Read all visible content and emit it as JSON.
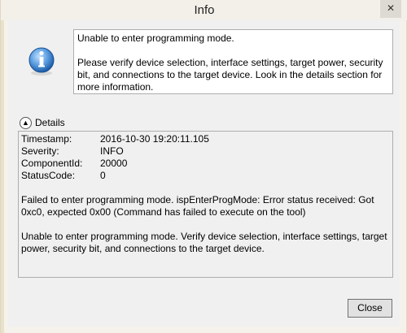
{
  "window": {
    "title": "Info",
    "close_glyph": "✕"
  },
  "message": {
    "icon": "info-icon",
    "line1": "Unable to enter programming mode.",
    "line2": "Please verify device selection, interface settings, target power, security bit, and connections to the target device. Look in the details section for more information."
  },
  "details": {
    "toggle_glyph": "▲",
    "label": "Details",
    "fields": [
      {
        "key": "Timestamp:",
        "value": "2016-10-30 19:20:11.105"
      },
      {
        "key": "Severity:",
        "value": "INFO"
      },
      {
        "key": "ComponentId:",
        "value": "20000"
      },
      {
        "key": "StatusCode:",
        "value": "0"
      }
    ],
    "paragraph1": "Failed to enter programming mode. ispEnterProgMode: Error status received: Got 0xc0, expected 0x00 (Command has failed to execute on the tool)",
    "paragraph2": "Unable to enter programming mode. Verify device selection, interface settings, target power, security bit, and connections to the target device."
  },
  "buttons": {
    "close_label": "Close"
  },
  "colors": {
    "title_bar": "#f2f0e8",
    "info_icon_blue": "#2a6fc0"
  }
}
